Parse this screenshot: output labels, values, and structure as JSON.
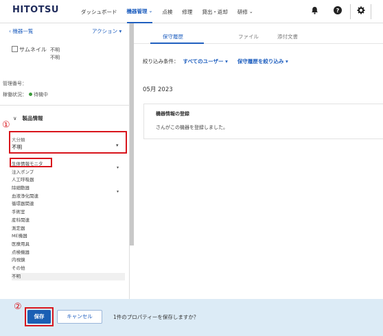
{
  "header": {
    "logo": "HITOTSU",
    "nav": [
      {
        "label": "ダッシュボード",
        "active": false,
        "has_chevron": false
      },
      {
        "label": "機器管理",
        "active": true,
        "has_chevron": true
      },
      {
        "label": "点検",
        "active": false,
        "has_chevron": false
      },
      {
        "label": "修理",
        "active": false,
        "has_chevron": false
      },
      {
        "label": "貸出・返却",
        "active": false,
        "has_chevron": false
      },
      {
        "label": "研修",
        "active": false,
        "has_chevron": true
      }
    ],
    "icons": [
      "bell-icon",
      "help-icon",
      "gear-icon"
    ]
  },
  "left": {
    "back_label": "機器一覧",
    "action_label": "アクション",
    "thumbnail_label": "サムネイル",
    "thumbnail_value1": "不明",
    "thumbnail_value2": "不明",
    "mgmt_label": "管理番号：",
    "status_label": "稼働状況：",
    "status_value": "待機中",
    "section_title": "製品情報",
    "field_label": "大分類",
    "field_value": "不明",
    "options": [
      "生体情報モニタ",
      "注入ポンプ",
      "人工呼吸器",
      "除細動器",
      "血液浄化関連",
      "循環器関連",
      "手術室",
      "産科関連",
      "測定器",
      "ME機器",
      "医療用具",
      "点検機器",
      "内視鏡",
      "その他",
      "不明"
    ],
    "selected_option": "不明"
  },
  "right": {
    "tabs": [
      "保守履歴",
      "ファイル",
      "添付文書"
    ],
    "active_tab": "保守履歴",
    "filter_label": "絞り込み条件：",
    "filter_user": "すべてのユーザー",
    "filter_history": "保守履歴を絞り込み",
    "month": "05月 2023",
    "card_title": "機器情報の登録",
    "card_text": "さんがこの機器を登録しました。"
  },
  "annotations": {
    "marker1": "①",
    "marker2": "②",
    "color": "#d8141b"
  },
  "footer": {
    "save_label": "保存",
    "cancel_label": "キャンセル",
    "confirm_text": "1件のプロパティーを保存しますか？"
  },
  "colors": {
    "accent": "#1f5fbf",
    "primary_button": "#1a5fb4",
    "footer_bg": "#dcebf6",
    "status_green": "#3a9a3a"
  }
}
